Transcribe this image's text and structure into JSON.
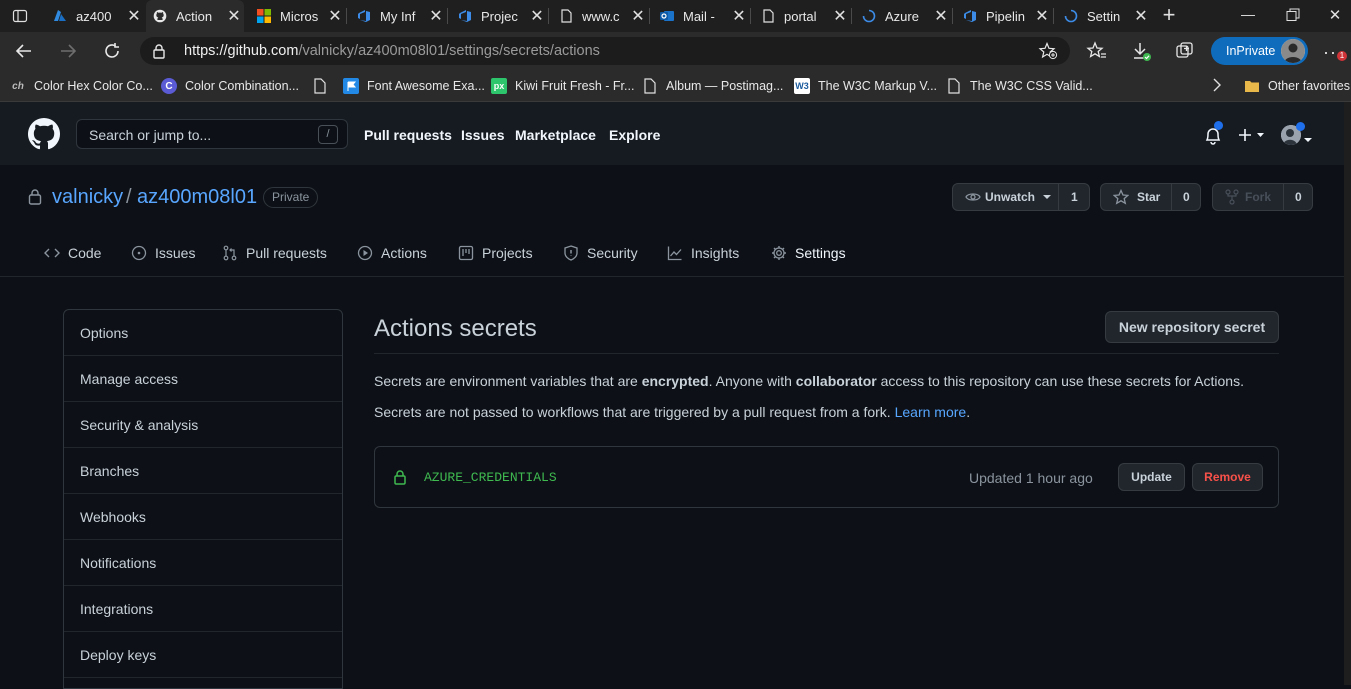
{
  "browser": {
    "tabs": [
      {
        "title": "az400",
        "icon": "azure-icon"
      },
      {
        "title": "Action",
        "icon": "github-icon",
        "active": true
      },
      {
        "title": "Micros",
        "icon": "microsoft-icon"
      },
      {
        "title": "My Inf",
        "icon": "devops-icon"
      },
      {
        "title": "Projec",
        "icon": "devops-icon"
      },
      {
        "title": "www.c",
        "icon": "page-icon"
      },
      {
        "title": "Mail -",
        "icon": "outlook-icon"
      },
      {
        "title": "portal",
        "icon": "page-icon"
      },
      {
        "title": "Azure",
        "icon": "loading-icon"
      },
      {
        "title": "Pipelin",
        "icon": "devops-icon"
      },
      {
        "title": "Settin",
        "icon": "loading-icon"
      }
    ],
    "url_host": "https://github.com",
    "url_path": "/valnicky/az400m08l01/settings/secrets/actions",
    "inprivate_label": "InPrivate",
    "bookmarks": [
      {
        "label": "Color Hex Color Co...",
        "icon": "colorhex-icon"
      },
      {
        "label": "Color Combination...",
        "icon": "color-c-icon"
      },
      {
        "label": "",
        "icon": "page-icon"
      },
      {
        "label": "Font Awesome Exa...",
        "icon": "fontawesome-icon"
      },
      {
        "label": "Kiwi Fruit Fresh - Fr...",
        "icon": "pixabay-icon"
      },
      {
        "label": "Album — Postimag...",
        "icon": "page-icon"
      },
      {
        "label": "The W3C Markup V...",
        "icon": "w3c-icon"
      },
      {
        "label": "The W3C CSS Valid...",
        "icon": "page-icon"
      }
    ],
    "other_favorites": "Other favorites"
  },
  "github": {
    "search_placeholder": "Search or jump to...",
    "search_key": "/",
    "nav": [
      "Pull requests",
      "Issues",
      "Marketplace",
      "Explore"
    ]
  },
  "repo": {
    "owner": "valnicky",
    "separator": "/",
    "name": "az400m08l01",
    "visibility": "Private",
    "unwatch_label": "Unwatch",
    "watch_count": "1",
    "star_label": "Star",
    "star_count": "0",
    "fork_label": "Fork",
    "fork_count": "0",
    "tabs": [
      "Code",
      "Issues",
      "Pull requests",
      "Actions",
      "Projects",
      "Security",
      "Insights",
      "Settings"
    ]
  },
  "sidebar": {
    "items": [
      "Options",
      "Manage access",
      "Security & analysis",
      "Branches",
      "Webhooks",
      "Notifications",
      "Integrations",
      "Deploy keys"
    ]
  },
  "main": {
    "title": "Actions secrets",
    "new_secret_button": "New repository secret",
    "p1_a": "Secrets are environment variables that are ",
    "p1_b": "encrypted",
    "p1_c": ". Anyone with ",
    "p1_d": "collaborator",
    "p1_e": " access to this repository can use these secrets for Actions.",
    "p2_a": "Secrets are not passed to workflows that are triggered by a pull request from a fork. ",
    "p2_link": "Learn more",
    "p2_end": ".",
    "secret": {
      "name": "AZURE_CREDENTIALS",
      "updated": "Updated 1 hour ago",
      "update_label": "Update",
      "remove_label": "Remove"
    }
  },
  "colors": {
    "accent": "#58a6ff",
    "secret_green": "#3fb950",
    "danger": "#f85149",
    "edge_blue": "#0f6cbd"
  }
}
